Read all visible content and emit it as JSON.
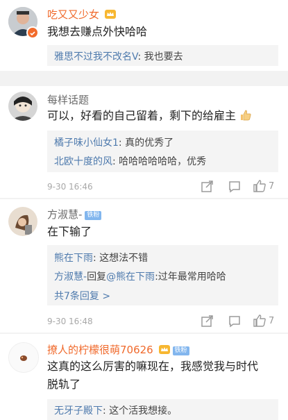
{
  "comments": [
    {
      "username": "吃又又少女",
      "content": "我想去赚点外快哈哈",
      "replies": [
        {
          "user": "雅思不过我不改名V",
          "text": ": 我也要去"
        }
      ]
    },
    {
      "username": "每样话题",
      "content": "可以，好看的自己留着，剩下的给雇主",
      "replies": [
        {
          "user": "橘子味小仙女1",
          "text": ": 真的优秀了"
        },
        {
          "user": "北欧十度的风",
          "text": ": 哈哈哈哈哈哈，优秀"
        }
      ],
      "time": "9-30 16:46",
      "like_count": "7"
    },
    {
      "username": "方淑慧-",
      "badge": "铁粉",
      "content": "在下输了",
      "replies": [
        {
          "user": "熊在下雨",
          "text": ": 这想法不错"
        },
        {
          "user": "方淑慧-",
          "mid": "回复",
          "user2": "@熊在下雨",
          "text": ":过年最常用哈哈"
        }
      ],
      "more_replies": "共7条回复 >",
      "time": "9-30 16:48",
      "like_count": "7"
    },
    {
      "username": "撩人的柠檬很萌70626",
      "badge": "铁粉",
      "content_line1": "这真的这么厉害的嘛现在，我感觉我与时代",
      "content_line2": "脱轨了",
      "replies": [
        {
          "user": "无牙子殿下",
          "text": ": 这个活我想接。"
        }
      ]
    }
  ],
  "colors": {
    "link_blue": "#4e7aad",
    "vip_orange": "#f0692b",
    "background": "#f2f2f2"
  }
}
